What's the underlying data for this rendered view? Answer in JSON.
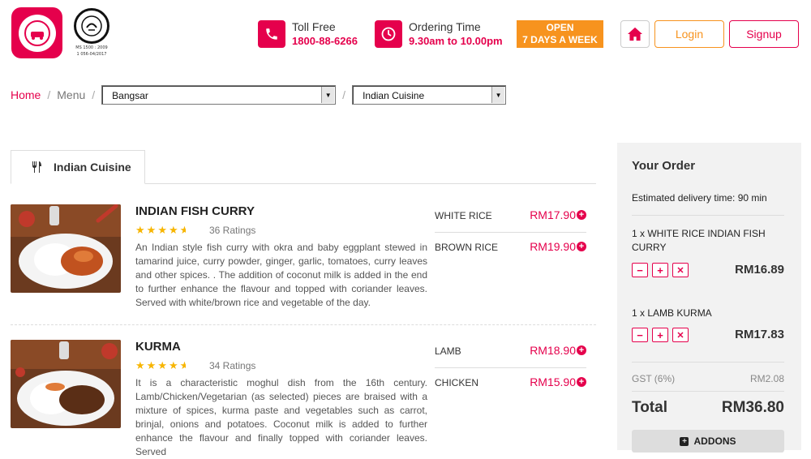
{
  "header": {
    "toll_free_label": "Toll Free",
    "toll_free_number": "1800-88-6266",
    "ordering_time_label": "Ordering Time",
    "ordering_time_value": "9.30am to 10.00pm",
    "open_line1": "OPEN",
    "open_line2": "7 DAYS A WEEK",
    "login_label": "Login",
    "signup_label": "Signup",
    "halal_cert_line1": "MS 1500 : 2009",
    "halal_cert_line2": "1 056-04/2017"
  },
  "breadcrumb": {
    "home": "Home",
    "menu": "Menu",
    "location_selected": "Bangsar",
    "cuisine_selected": "Indian Cuisine"
  },
  "tab": {
    "label": "Indian Cuisine"
  },
  "dishes": [
    {
      "name": "INDIAN FISH CURRY",
      "rating": 4.5,
      "ratings_text": "36 Ratings",
      "description": "An Indian style fish curry with okra and baby eggplant stewed in tamarind juice, curry powder, ginger, garlic, tomatoes, curry leaves and other spices. . The addition of coconut milk is added in the end to further enhance the flavour and topped with coriander leaves. Served with white/brown rice and vegetable of the day.",
      "options": [
        {
          "label": "WHITE RICE",
          "price": "RM17.90"
        },
        {
          "label": "BROWN RICE",
          "price": "RM19.90"
        }
      ]
    },
    {
      "name": "KURMA",
      "rating": 4.5,
      "ratings_text": "34 Ratings",
      "description": "It is a characteristic moghul dish from the 16th century. Lamb/Chicken/Vegetarian (as selected) pieces are braised with a mixture of spices, kurma paste and vegetables such as carrot, brinjal, onions and potatoes. Coconut milk is added to further enhance the flavour and finally topped with coriander leaves. Served",
      "options": [
        {
          "label": "LAMB",
          "price": "RM18.90"
        },
        {
          "label": "CHICKEN",
          "price": "RM15.90"
        }
      ]
    }
  ],
  "order": {
    "title": "Your Order",
    "eta": "Estimated delivery time: 90 min",
    "items": [
      {
        "name": "1 x WHITE RICE INDIAN FISH CURRY",
        "price": "RM16.89"
      },
      {
        "name": "1 x LAMB KURMA",
        "price": "RM17.83"
      }
    ],
    "gst_label": "GST (6%)",
    "gst_value": "RM2.08",
    "total_label": "Total",
    "total_value": "RM36.80",
    "addons_label": "ADDONS"
  },
  "colors": {
    "brand": "#e5004c",
    "accent": "#f7931e",
    "star": "#f7b500"
  }
}
